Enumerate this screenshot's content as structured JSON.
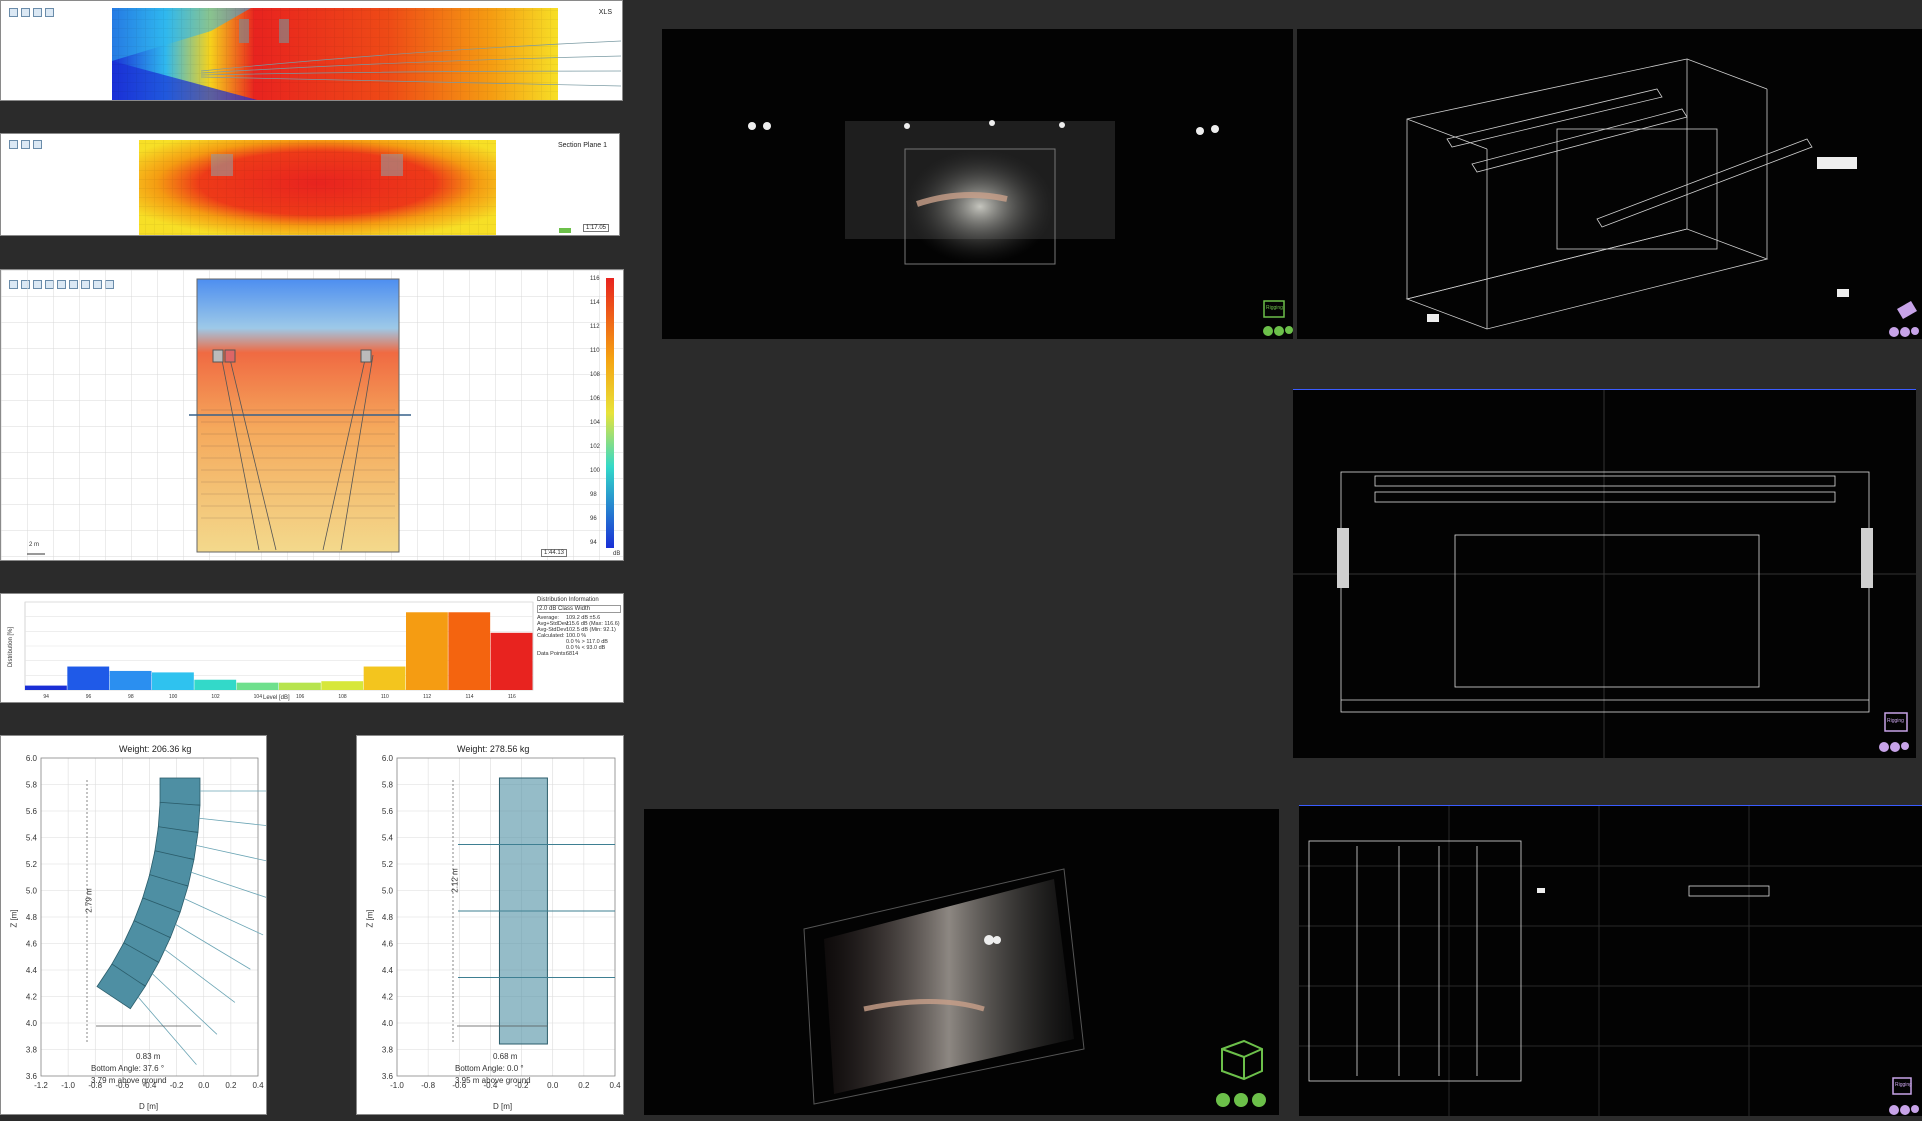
{
  "colors": {
    "background": "#2b2b2b",
    "viewport": "#030303",
    "rigging_badge_green": "#6cc04a",
    "rigging_badge_purple": "#c7a3e8",
    "array_fill": "#4e8fa3",
    "spl_high": "#e8231f",
    "spl_low": "#1a2fd6"
  },
  "section_top": {
    "label": "XLS"
  },
  "section_plane": {
    "label": "Section Plane 1",
    "scale": "1:17.05"
  },
  "plan_view": {
    "scale_bar": "2 m",
    "scale": "1:44.13",
    "colorbar_unit": "dB",
    "colorbar_ticks": [
      "116",
      "114",
      "112",
      "110",
      "108",
      "106",
      "104",
      "102",
      "100",
      "98",
      "96",
      "94"
    ]
  },
  "histogram": {
    "info_title": "Distribution Information",
    "class_width": "2.0 dB Class Width",
    "stats": [
      {
        "k": "Average:",
        "v": "109.2 dB ±5.6"
      },
      {
        "k": "Avg+StdDev:",
        "v": "115.6 dB (Max: 116.6)"
      },
      {
        "k": "Avg-StdDev:",
        "v": "102.5 dB (Min: 92.1)"
      },
      {
        "k": "Calculated:",
        "v": "100.0 %"
      },
      {
        "k": "",
        "v": "0.0 % > 117.0 dB"
      },
      {
        "k": "",
        "v": "0.0 % < 93.0 dB"
      },
      {
        "k": "Data Points:",
        "v": "6814"
      }
    ]
  },
  "chart_data": {
    "type": "bar",
    "categories": [
      "94",
      "96",
      "98",
      "100",
      "102",
      "104",
      "106",
      "108",
      "110",
      "112",
      "114",
      "116"
    ],
    "values": [
      3,
      16,
      13,
      12,
      7,
      5,
      5,
      6,
      16,
      53,
      53,
      39
    ],
    "xlabel": "Level [dB]",
    "ylabel": "Distribution [%]",
    "colors": [
      "#1a2fd6",
      "#1f5ae8",
      "#2b8ff0",
      "#2fc2ef",
      "#33d9c9",
      "#6fe08d",
      "#b7e44e",
      "#d7e73a",
      "#f3c51e",
      "#f59c12",
      "#f4640f",
      "#e8231f"
    ]
  },
  "array_left": {
    "weight": "Weight: 206.36 kg",
    "height_dim": "2.79 m",
    "width_dim": "0.83 m",
    "bottom_angle": "Bottom Angle: 37.6 °",
    "above_ground": "3.79 m above ground",
    "y_axis_label": "Z [m]",
    "x_axis_label": "D [m]",
    "y_ticks": [
      "6.0",
      "5.8",
      "5.6",
      "5.4",
      "5.2",
      "5.0",
      "4.8",
      "4.6",
      "4.4",
      "4.2",
      "4.0",
      "3.8",
      "3.6"
    ],
    "x_ticks": [
      "-1.2",
      "-1.0",
      "-0.8",
      "-0.6",
      "-0.4",
      "-0.2",
      "0.0",
      "0.2",
      "0.4"
    ]
  },
  "array_right": {
    "weight": "Weight: 278.56 kg",
    "height_dim": "2.12 m",
    "width_dim": "0.68 m",
    "bottom_angle": "Bottom Angle: 0.0 °",
    "above_ground": "3.95 m above ground",
    "y_axis_label": "Z [m]",
    "x_axis_label": "D [m]",
    "y_ticks": [
      "6.0",
      "5.8",
      "5.6",
      "5.4",
      "5.2",
      "5.0",
      "4.8",
      "4.6",
      "4.4",
      "4.2",
      "4.0",
      "3.8",
      "3.6"
    ],
    "x_ticks": [
      "-1.0",
      "-0.8",
      "-0.6",
      "-0.4",
      "-0.2",
      "0.0",
      "0.2",
      "0.4"
    ]
  },
  "viewports": {
    "rigging_label": "Rigging"
  }
}
